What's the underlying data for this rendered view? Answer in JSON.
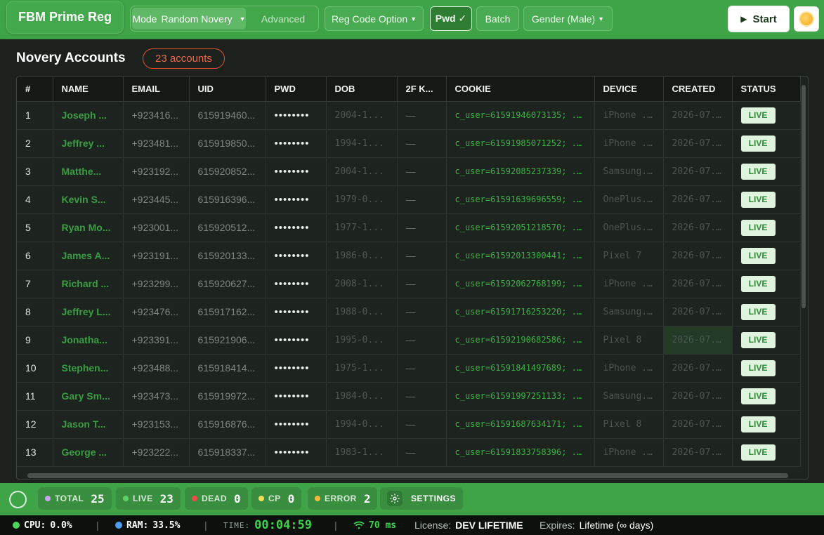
{
  "app": {
    "title": "FBM Prime Reg"
  },
  "toolbar": {
    "mode_label": "Mode",
    "mode_value": "Random Novery",
    "advanced_label": "Advanced",
    "reg_code_label": "Reg Code Option",
    "pwd_label": "Pwd ✓",
    "batch_label": "Batch",
    "gender_label": "Gender (Male)",
    "start_label": "Start"
  },
  "header": {
    "title": "Novery Accounts",
    "badge": "23 accounts"
  },
  "table": {
    "columns": [
      "#",
      "NAME",
      "EMAIL",
      "UID",
      "PWD",
      "DOB",
      "2F K...",
      "COOKIE",
      "DEVICE",
      "CREATED",
      "STATUS"
    ],
    "rows": [
      {
        "num": "1",
        "name": "Joseph ...",
        "email": "+923416...",
        "uid": "615919460...",
        "pwd": "••••••••",
        "dob": "2004-1...",
        "twofk": "—",
        "cookie": "c_user=61591946073135; ...",
        "device": "iPhone ...",
        "created": "2026-07...",
        "status": "LIVE"
      },
      {
        "num": "2",
        "name": "Jeffrey ...",
        "email": "+923481...",
        "uid": "615919850...",
        "pwd": "••••••••",
        "dob": "1994-1...",
        "twofk": "—",
        "cookie": "c_user=61591985071252; ...",
        "device": "iPhone ...",
        "created": "2026-07...",
        "status": "LIVE"
      },
      {
        "num": "3",
        "name": "Matthe...",
        "email": "+923192...",
        "uid": "615920852...",
        "pwd": "••••••••",
        "dob": "2004-1...",
        "twofk": "—",
        "cookie": "c_user=61592085237339; ...",
        "device": "Samsung...",
        "created": "2026-07...",
        "status": "LIVE"
      },
      {
        "num": "4",
        "name": "Kevin S...",
        "email": "+923445...",
        "uid": "615916396...",
        "pwd": "••••••••",
        "dob": "1979-0...",
        "twofk": "—",
        "cookie": "c_user=61591639696559; ...",
        "device": "OnePlus...",
        "created": "2026-07...",
        "status": "LIVE"
      },
      {
        "num": "5",
        "name": "Ryan Mo...",
        "email": "+923001...",
        "uid": "615920512...",
        "pwd": "••••••••",
        "dob": "1977-1...",
        "twofk": "—",
        "cookie": "c_user=61592051218570; ...",
        "device": "OnePlus...",
        "created": "2026-07...",
        "status": "LIVE"
      },
      {
        "num": "6",
        "name": "James A...",
        "email": "+923191...",
        "uid": "615920133...",
        "pwd": "••••••••",
        "dob": "1986-0...",
        "twofk": "—",
        "cookie": "c_user=61592013300441; ...",
        "device": "Pixel 7",
        "created": "2026-07...",
        "status": "LIVE"
      },
      {
        "num": "7",
        "name": "Richard ...",
        "email": "+923299...",
        "uid": "615920627...",
        "pwd": "••••••••",
        "dob": "2008-1...",
        "twofk": "—",
        "cookie": "c_user=61592062768199; ...",
        "device": "iPhone ...",
        "created": "2026-07...",
        "status": "LIVE"
      },
      {
        "num": "8",
        "name": "Jeffrey L...",
        "email": "+923476...",
        "uid": "615917162...",
        "pwd": "••••••••",
        "dob": "1988-0...",
        "twofk": "—",
        "cookie": "c_user=61591716253220; ...",
        "device": "Samsung...",
        "created": "2026-07...",
        "status": "LIVE"
      },
      {
        "num": "9",
        "name": "Jonatha...",
        "email": "+923391...",
        "uid": "615921906...",
        "pwd": "••••••••",
        "dob": "1995-0...",
        "twofk": "—",
        "cookie": "c_user=61592190682586; ...",
        "device": "Pixel 8",
        "created": "2026-07...",
        "status": "LIVE"
      },
      {
        "num": "10",
        "name": "Stephen...",
        "email": "+923488...",
        "uid": "615918414...",
        "pwd": "••••••••",
        "dob": "1975-1...",
        "twofk": "—",
        "cookie": "c_user=61591841497689; ...",
        "device": "iPhone ...",
        "created": "2026-07...",
        "status": "LIVE"
      },
      {
        "num": "11",
        "name": "Gary Sm...",
        "email": "+923473...",
        "uid": "615919972...",
        "pwd": "••••••••",
        "dob": "1984-0...",
        "twofk": "—",
        "cookie": "c_user=61591997251133; ...",
        "device": "Samsung...",
        "created": "2026-07...",
        "status": "LIVE"
      },
      {
        "num": "12",
        "name": "Jason T...",
        "email": "+923153...",
        "uid": "615916876...",
        "pwd": "••••••••",
        "dob": "1994-0...",
        "twofk": "—",
        "cookie": "c_user=61591687634171; ...",
        "device": "Pixel 8",
        "created": "2026-07...",
        "status": "LIVE"
      },
      {
        "num": "13",
        "name": "George ...",
        "email": "+923222...",
        "uid": "615918337...",
        "pwd": "••••••••",
        "dob": "1983-1...",
        "twofk": "—",
        "cookie": "c_user=61591833758396; ...",
        "device": "iPhone ...",
        "created": "2026-07...",
        "status": "LIVE"
      }
    ]
  },
  "stats": {
    "total": {
      "label": "TOTAL",
      "value": "25",
      "color": "#c9a6f2"
    },
    "live": {
      "label": "LIVE",
      "value": "23",
      "color": "#5fd068"
    },
    "dead": {
      "label": "DEAD",
      "value": "0",
      "color": "#f04b4b"
    },
    "cp": {
      "label": "CP",
      "value": "0",
      "color": "#f5dd5a"
    },
    "error": {
      "label": "ERROR",
      "value": "2",
      "color": "#f5b942"
    },
    "settings_label": "SETTINGS"
  },
  "statusline": {
    "cpu_label": "CPU:",
    "cpu_value": "0.0%",
    "ram_label": "RAM:",
    "ram_value": "33.5%",
    "time_label": "TIME:",
    "time_value": "00:04:59",
    "ping": "70 ms",
    "license_label": "License:",
    "license_value": "DEV LIFETIME",
    "expires_label": "Expires:",
    "expires_value": "Lifetime (∞ days)"
  },
  "colors": {
    "accent": "#3fa347",
    "live_badge_bg": "#dff3df",
    "name_green": "#3a9d43",
    "cookie_green": "#3bb143"
  }
}
